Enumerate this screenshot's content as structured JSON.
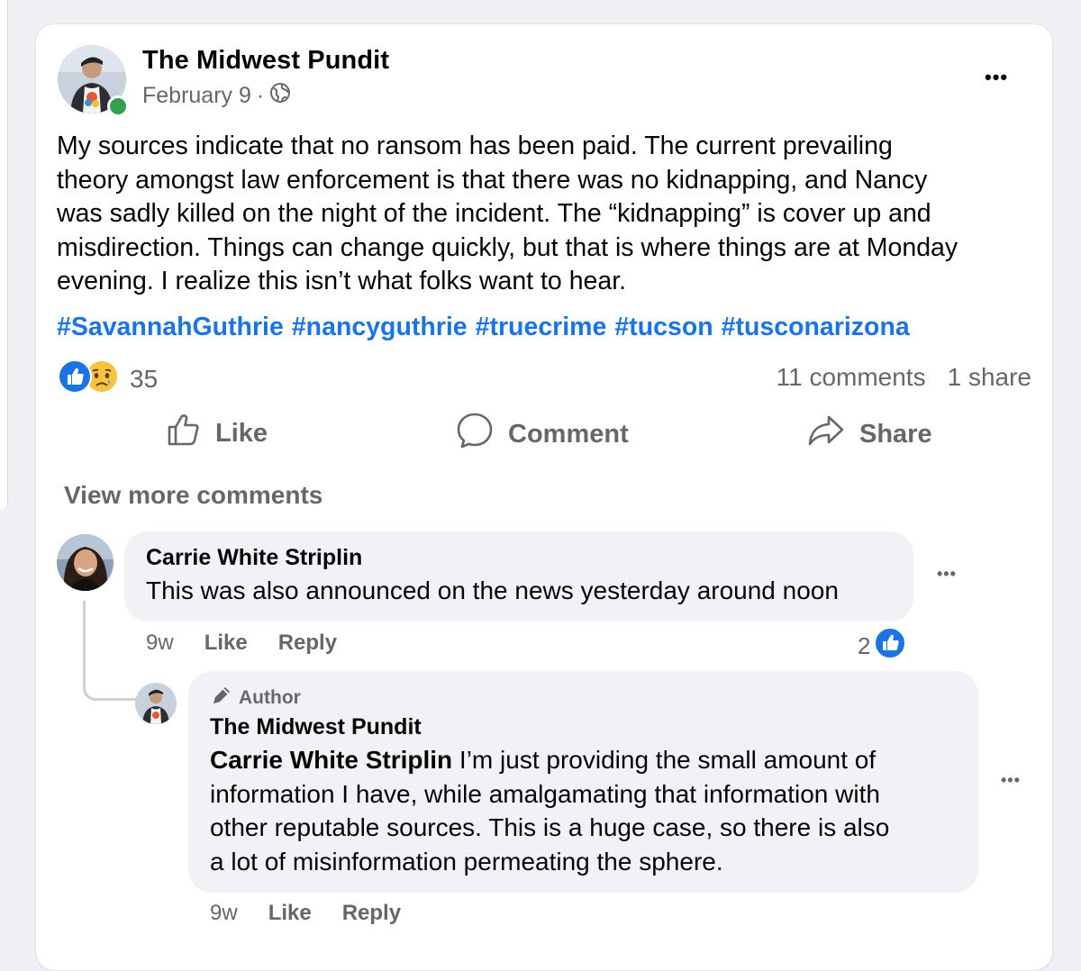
{
  "post": {
    "author": "The Midwest Pundit",
    "date": "February 9",
    "separator": "·",
    "more_icon": "•••",
    "text_lines": [
      "My sources indicate that no ransom has been paid.  The current prevailing",
      "theory amongst law enforcement is that there was no kidnapping, and Nancy",
      "was sadly killed on the night of the incident.  The “kidnapping” is cover up and",
      "misdirection. Things can change quickly, but that is where things are at Monday",
      "evening. I realize this isn’t what folks want to hear."
    ],
    "hashtags": [
      "#SavannahGuthrie",
      "#nancyguthrie",
      "#truecrime",
      "#tucson",
      "#tusconarizona"
    ],
    "reaction_count": "35",
    "comments_count": "11 comments",
    "shares_count": "1 share",
    "icons": {
      "like": "like-icon",
      "sad": "sad-icon",
      "globe": "globe-icon",
      "comment": "comment-icon",
      "share": "share-icon"
    }
  },
  "actions": {
    "like": "Like",
    "comment": "Comment",
    "share": "Share"
  },
  "view_more_comments": "View more comments",
  "comments": [
    {
      "author": "Carrie White Striplin",
      "text": "This was also announced on the news yesterday around noon",
      "time": "9w",
      "like": "Like",
      "reply": "Reply",
      "likes": "2"
    }
  ],
  "reply": {
    "badge": "Author",
    "author": "The Midwest Pundit",
    "mention": "Carrie White Striplin",
    "text_first": " I’m just providing the small amount of",
    "text_rest": [
      "information I have, while amalgamating that information with",
      "other reputable sources. This is a huge case, so there is also",
      "a lot of misinformation permeating the sphere."
    ],
    "time": "9w",
    "like": "Like",
    "reply": "Reply"
  },
  "colors": {
    "link_blue": "#1b74e4",
    "secondary_text": "#65676b",
    "bubble_bg": "#f0f2f5",
    "online_green": "#31a24c"
  }
}
